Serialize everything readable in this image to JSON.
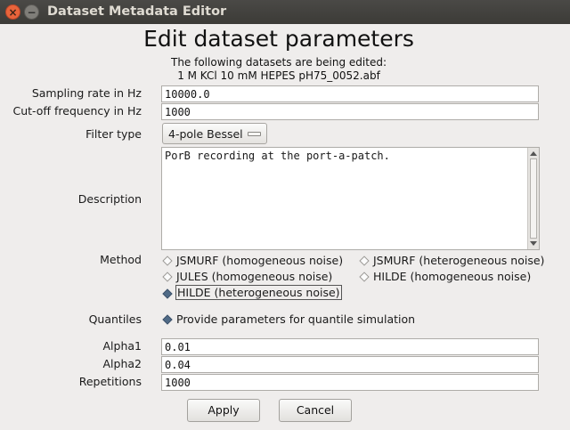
{
  "window": {
    "title": "Dataset Metadata Editor",
    "close_glyph": "×",
    "minimize_glyph": "−"
  },
  "header": {
    "title": "Edit dataset parameters",
    "subtitle": "The following datasets are being edited:",
    "dataset": "1 M KCl 10 mM HEPES  pH75_0052.abf"
  },
  "form": {
    "sampling_rate": {
      "label": "Sampling rate in Hz",
      "value": "10000.0"
    },
    "cutoff": {
      "label": "Cut-off frequency in Hz",
      "value": "1000"
    },
    "filter": {
      "label": "Filter type",
      "selected": "4-pole Bessel"
    },
    "description": {
      "label": "Description",
      "value": "PorB recording at the port-a-patch."
    },
    "method": {
      "label": "Method",
      "options": [
        {
          "label": "JSMURF (homogeneous noise)",
          "selected": false
        },
        {
          "label": "JSMURF (heterogeneous noise)",
          "selected": false
        },
        {
          "label": "JULES (homogeneous noise)",
          "selected": false
        },
        {
          "label": "HILDE (homogeneous noise)",
          "selected": false
        },
        {
          "label": "HILDE (heterogeneous noise)",
          "selected": true
        }
      ]
    },
    "quantiles": {
      "label": "Quantiles",
      "option": "Provide parameters for quantile simulation",
      "selected": true
    },
    "alpha1": {
      "label": "Alpha1",
      "value": "0.01"
    },
    "alpha2": {
      "label": "Alpha2",
      "value": "0.04"
    },
    "repetitions": {
      "label": "Repetitions",
      "value": "1000"
    }
  },
  "buttons": {
    "apply": "Apply",
    "cancel": "Cancel"
  },
  "colors": {
    "titlebar": "#3c3b37",
    "close": "#e9643b",
    "radio_selected": "#4f6a86",
    "background": "#efedec"
  }
}
